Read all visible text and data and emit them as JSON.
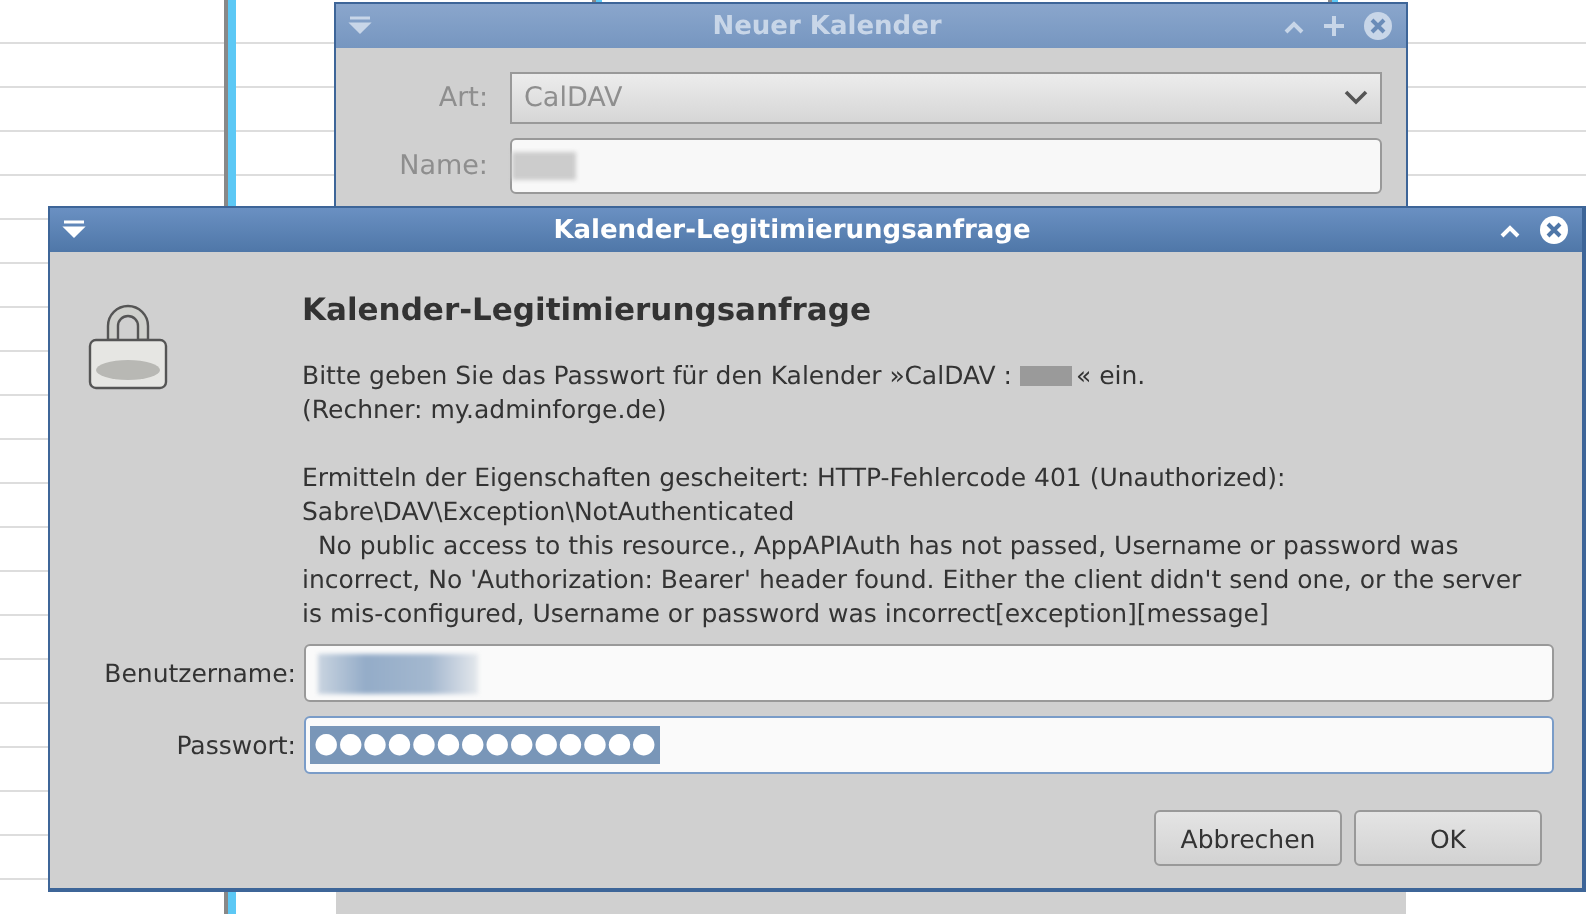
{
  "background_window": {
    "title": "Neuer Kalender",
    "fields": [
      {
        "label": "Art:",
        "kind": "dropdown",
        "value": "CalDAV"
      },
      {
        "label": "Name:",
        "kind": "text",
        "redacted": true
      }
    ]
  },
  "dialog": {
    "title": "Kalender-Legitimierungsanfrage",
    "heading": "Kalender-Legitimierungsanfrage",
    "prompt_start": "Bitte geben Sie das Passwort für den Kalender »CalDAV :",
    "prompt_end": "« ein.",
    "host": "(Rechner: my.adminforge.de)",
    "error": "Ermitteln der Eigenschaften gescheitert: HTTP-Fehlercode 401 (Unauthorized):\nSabre\\DAV\\Exception\\NotAuthenticated\n  No public access to this resource., AppAPIAuth has not passed, Username or password was\nincorrect, No 'Authorization: Bearer' header found. Either the client didn't send one, or the server\nis mis-configured, Username or password was incorrect[exception][message]",
    "fields": [
      {
        "label": "Benutzername:",
        "kind": "text",
        "redacted": true
      },
      {
        "label": "Passwort:",
        "kind": "password",
        "value": "●●●●●●●●●●●●●●",
        "selected": true
      }
    ],
    "buttons": [
      "Abbrechen",
      "OK"
    ]
  }
}
